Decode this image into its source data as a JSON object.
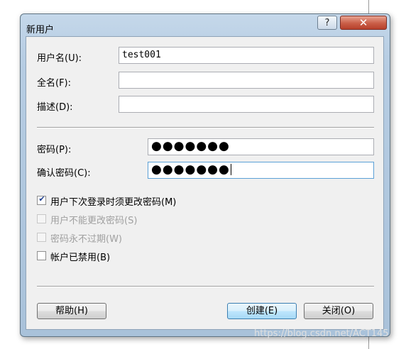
{
  "dialog": {
    "title": "新用户",
    "help_glyph": "?",
    "close_glyph": "✕"
  },
  "fields": {
    "username": {
      "label": "用户名(U):",
      "value": "test001"
    },
    "fullname": {
      "label": "全名(F):",
      "value": ""
    },
    "description": {
      "label": "描述(D):",
      "value": ""
    },
    "password": {
      "label": "密码(P):",
      "value": "●●●●●●●"
    },
    "confirm_password": {
      "label": "确认密码(C):",
      "value": "●●●●●●●"
    }
  },
  "checkboxes": [
    {
      "label": "用户下次登录时须更改密码(M)",
      "checked": true,
      "enabled": true
    },
    {
      "label": "用户不能更改密码(S)",
      "checked": false,
      "enabled": false
    },
    {
      "label": "密码永不过期(W)",
      "checked": false,
      "enabled": false
    },
    {
      "label": "帐户已禁用(B)",
      "checked": false,
      "enabled": true
    }
  ],
  "buttons": {
    "help": "帮助(H)",
    "create": "创建(E)",
    "close": "关闭(O)"
  },
  "watermark": "https://blog.csdn.net/ACT145",
  "colors": {
    "title_gradient_top": "#c5d8ea",
    "close_button": "#c95e47",
    "client_background": "#f0f0f0",
    "check_mark": "#1f3f8f"
  }
}
